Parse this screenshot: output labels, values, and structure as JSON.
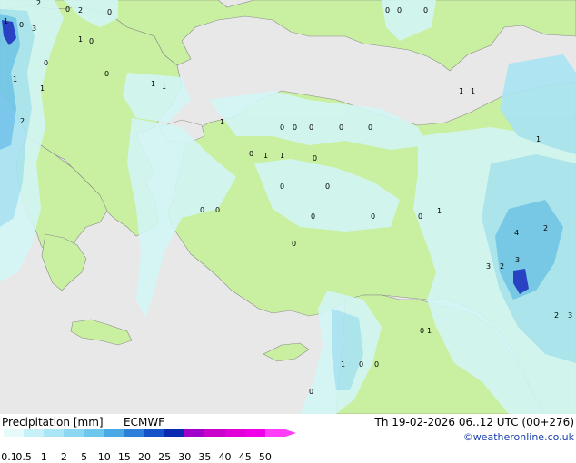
{
  "map": {
    "region": "Eastern Mediterranean / Anatolia",
    "colors": {
      "sea": "#e8e8e8",
      "land": "#c8f0a0",
      "border": "#8a8a8a",
      "precip_light": "#d3f6f6",
      "precip_medium": "#a8e4f4",
      "precip_heavy": "#6fc4ec",
      "precip_max": "#1830c8"
    },
    "values": [
      "2",
      "0",
      "2",
      "0",
      "1",
      "0",
      "3",
      "0",
      "1",
      "0",
      "1",
      "1",
      "1",
      "1",
      "2",
      "0",
      "1",
      "0",
      "0",
      "0",
      "0",
      "0",
      "0",
      "0",
      "0",
      "0",
      "1",
      "1",
      "0",
      "0",
      "0",
      "0",
      "0",
      "0",
      "0",
      "0",
      "0",
      "1",
      "1",
      "4",
      "2",
      "3",
      "2",
      "3",
      "1",
      "1",
      "1",
      "0",
      "0",
      "0",
      "3",
      "2",
      "1",
      "0"
    ]
  },
  "footer": {
    "title": "Precipitation [mm]",
    "model": "ECMWF",
    "datetime": "Th 19-02-2026 06..12 UTC (00+276)",
    "credit": "©weatheronline.co.uk",
    "scale_labels": [
      "0.1",
      "0.5",
      "1",
      "2",
      "5",
      "10",
      "15",
      "20",
      "25",
      "30",
      "35",
      "40",
      "45",
      "50"
    ],
    "scale_colors": [
      "#e6fafa",
      "#c8f0f8",
      "#aae6f6",
      "#8cd8f2",
      "#6ec8ee",
      "#4aa8e4",
      "#2c80da",
      "#1452c8",
      "#0a28b0",
      "#a000c8",
      "#c800c8",
      "#e000d8",
      "#f000e8",
      "#ff3cf8"
    ]
  }
}
